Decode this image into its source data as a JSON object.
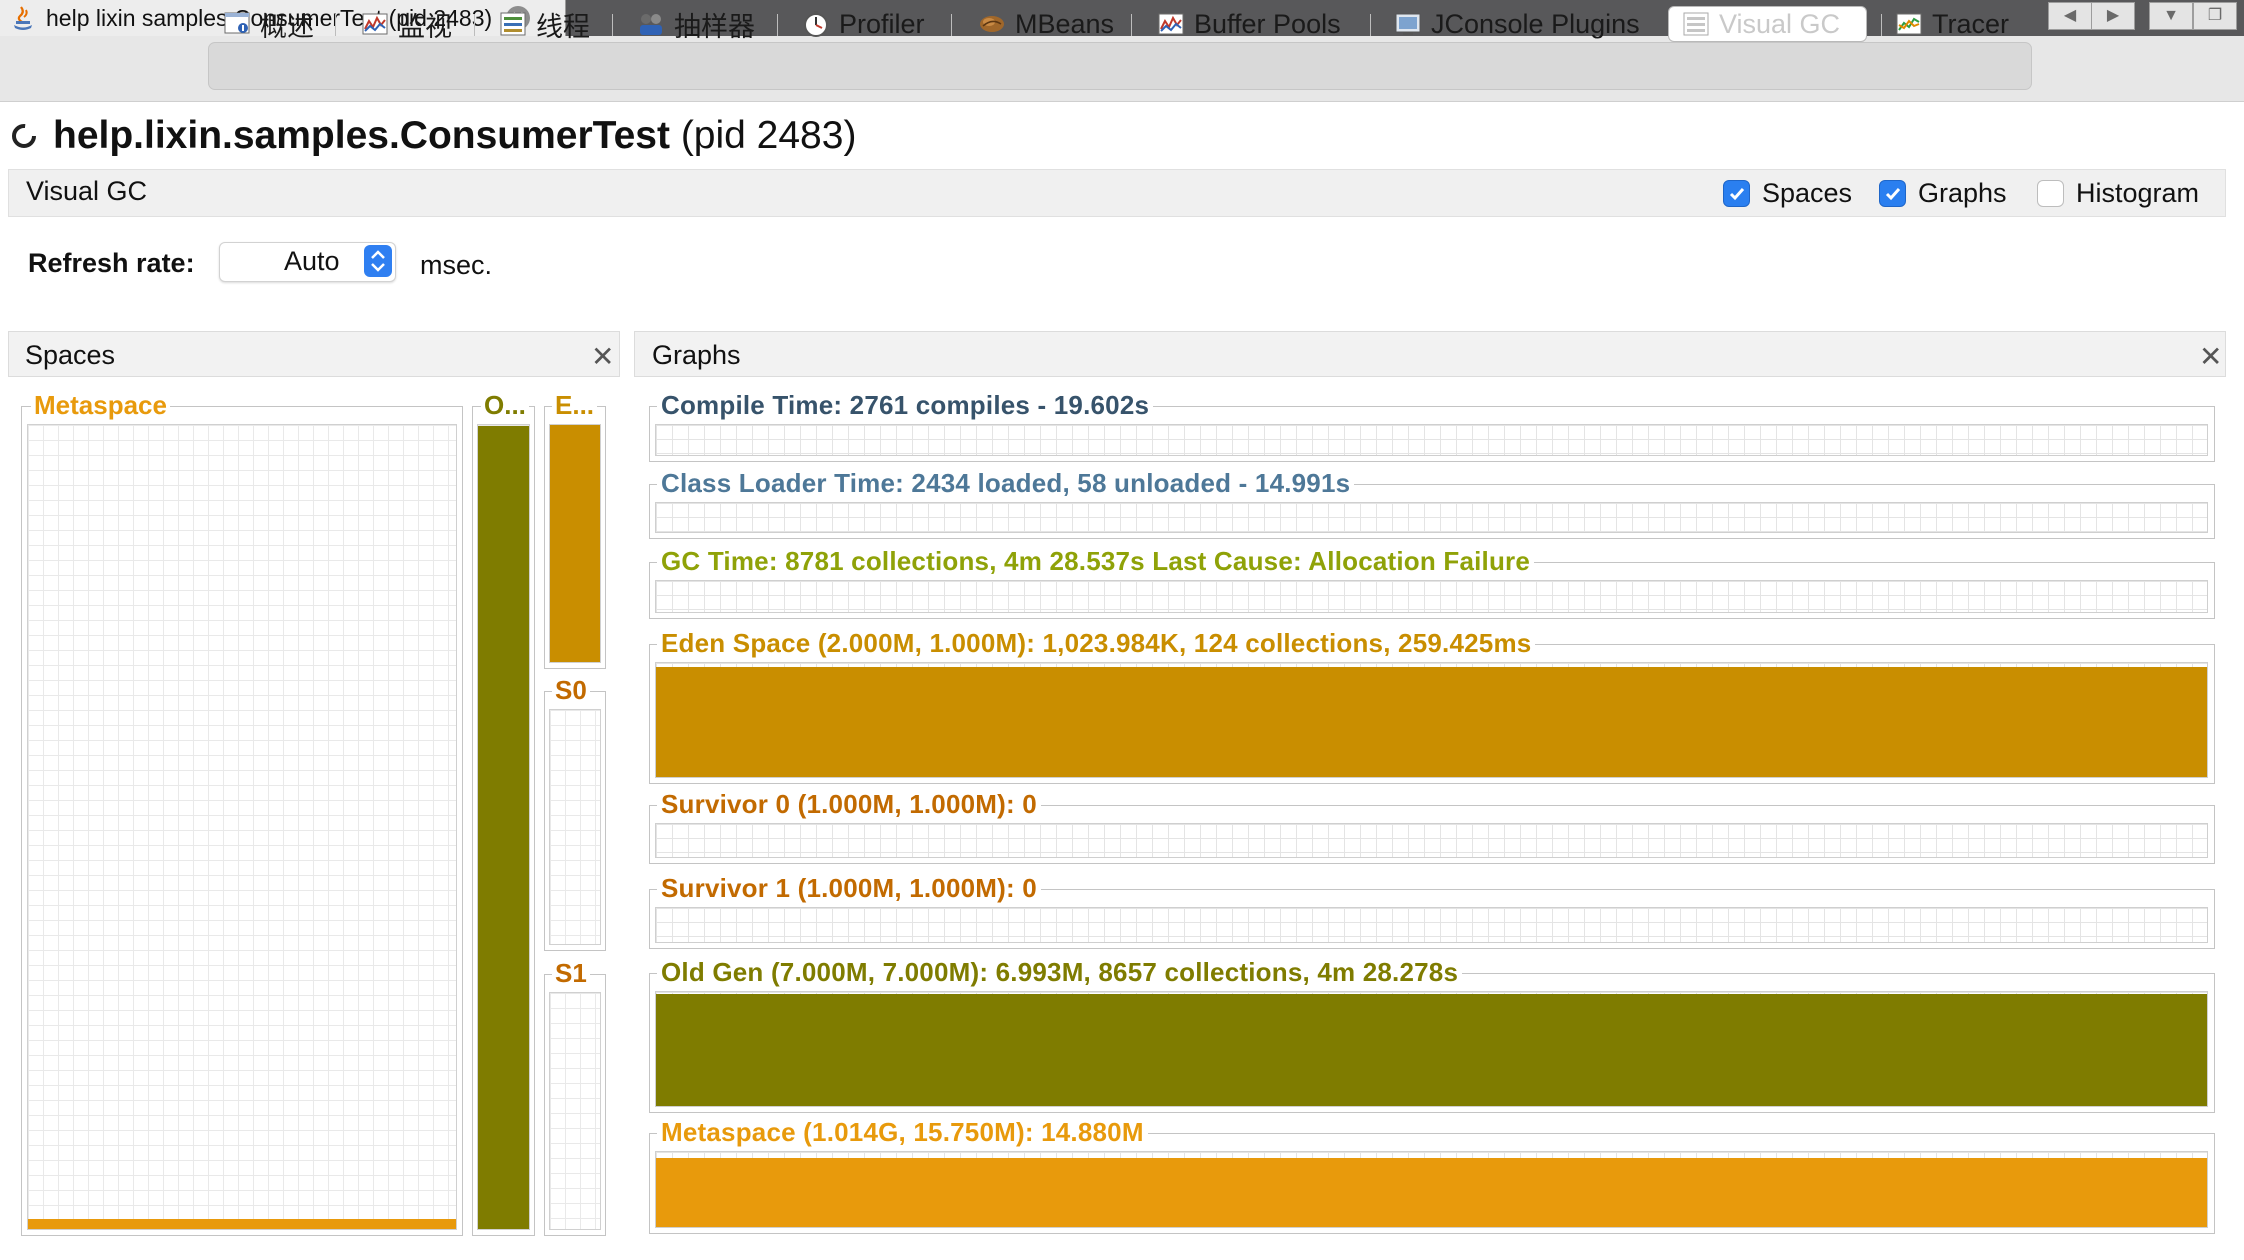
{
  "window": {
    "tab_title": "help lixin samples ConsumerTest (pid 2483)",
    "tab_close": "✕",
    "nav_prev": "◀",
    "nav_next": "▶",
    "menu": "▼",
    "restore": "❐"
  },
  "toolbar": {
    "tabs": [
      {
        "label": "概述",
        "icon": "overview-icon"
      },
      {
        "label": "监视",
        "icon": "monitor-icon"
      },
      {
        "label": "线程",
        "icon": "threads-icon"
      },
      {
        "label": "抽样器",
        "icon": "sampler-icon"
      },
      {
        "label": "Profiler",
        "icon": "profiler-icon"
      },
      {
        "label": "MBeans",
        "icon": "mbeans-icon"
      },
      {
        "label": "Buffer Pools",
        "icon": "buffer-pools-icon"
      },
      {
        "label": "JConsole Plugins",
        "icon": "jconsole-icon"
      },
      {
        "label": "Visual GC",
        "icon": "visual-gc-icon",
        "active": true
      },
      {
        "label": "Tracer",
        "icon": "tracer-icon"
      }
    ]
  },
  "heading": {
    "app_name": "help.lixin.samples.ConsumerTest",
    "pid": "(pid 2483)"
  },
  "visual_gc": {
    "label": "Visual GC",
    "options": [
      {
        "label": "Spaces",
        "checked": true
      },
      {
        "label": "Graphs",
        "checked": true
      },
      {
        "label": "Histogram",
        "checked": false
      }
    ],
    "refresh": {
      "label": "Refresh rate:",
      "value": "Auto",
      "unit": "msec."
    }
  },
  "spaces_panel": {
    "title": "Spaces",
    "close": "✕",
    "metaspace": {
      "label": "Metaspace",
      "color": "#e89a0c",
      "used_fraction": 0.012
    },
    "old": {
      "label": "O...",
      "color": "#7f7c00",
      "used_fraction": 0.999
    },
    "eden": {
      "label": "E...",
      "color": "#c98e00",
      "used_fraction": 1.0
    },
    "s0": {
      "label": "S0",
      "color": "#c26a00",
      "used_fraction": 0.0
    },
    "s1": {
      "label": "S1",
      "color": "#c26a00",
      "used_fraction": 0.0
    }
  },
  "graphs_panel": {
    "title": "Graphs",
    "close": "✕",
    "graphs": [
      {
        "label": "Compile Time: 2761 compiles - 19.602s",
        "color": "#37536b",
        "fill": null
      },
      {
        "label": "Class Loader Time: 2434 loaded, 58 unloaded - 14.991s",
        "color": "#4e7898",
        "fill": null
      },
      {
        "label": "GC Time: 8781 collections, 4m 28.537s  Last Cause: Allocation Failure",
        "color": "#8fa208",
        "fill": null
      },
      {
        "label": "Eden Space (2.000M, 1.000M): 1,023.984K, 124 collections, 259.425ms",
        "color": "#c98e00",
        "fill": "#c98e00"
      },
      {
        "label": "Survivor 0 (1.000M, 1.000M): 0",
        "color": "#c26a00",
        "fill": null
      },
      {
        "label": "Survivor 1 (1.000M, 1.000M): 0",
        "color": "#c26a00",
        "fill": null
      },
      {
        "label": "Old Gen (7.000M, 7.000M): 6.993M, 8657 collections, 4m 28.278s",
        "color": "#7f7c00",
        "fill": "#7f7c00"
      },
      {
        "label": "Metaspace (1.014G, 15.750M): 14.880M",
        "color": "#e89a0c",
        "fill": "#e89a0c"
      }
    ]
  }
}
